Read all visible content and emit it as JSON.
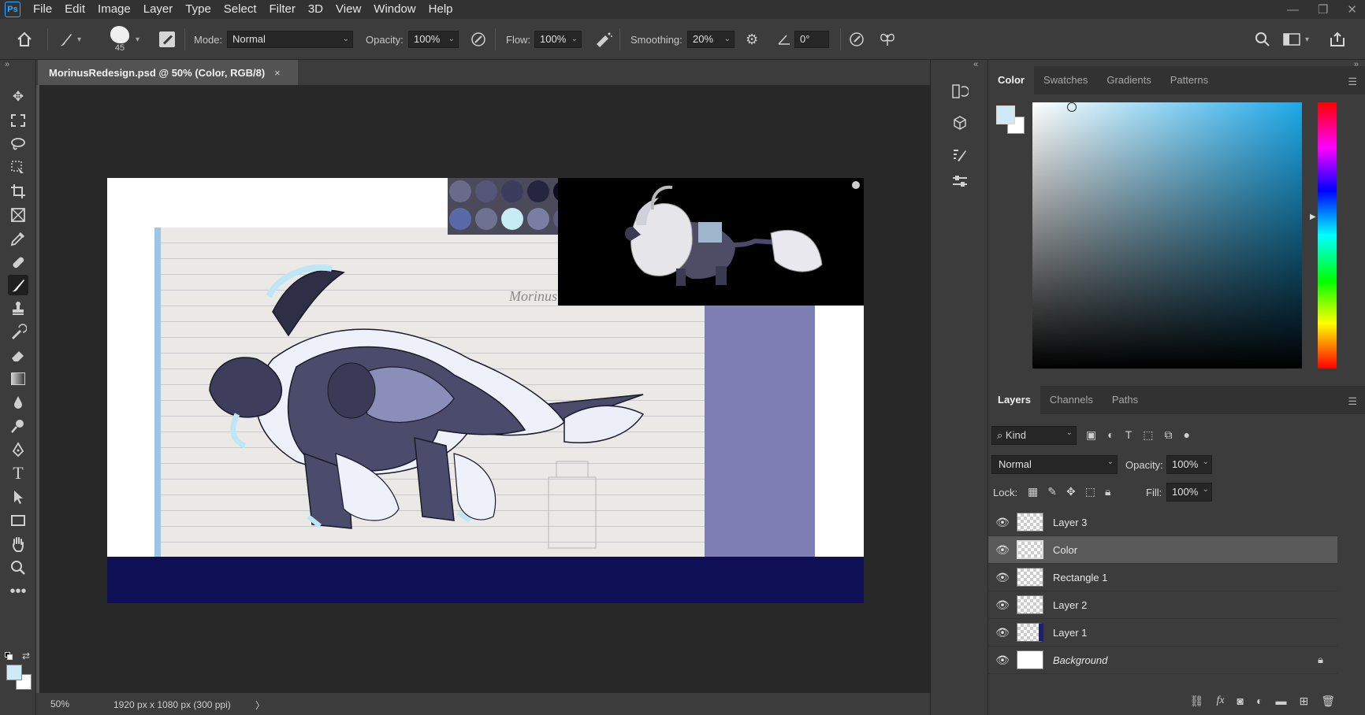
{
  "app": {
    "logo": "Ps"
  },
  "menu": [
    "File",
    "Edit",
    "Image",
    "Layer",
    "Type",
    "Select",
    "Filter",
    "3D",
    "View",
    "Window",
    "Help"
  ],
  "window_controls": {
    "minimize": "—",
    "restore": "❐",
    "close": "✕"
  },
  "options": {
    "brush_size": "45",
    "mode_label": "Mode:",
    "mode_value": "Normal",
    "opacity_label": "Opacity:",
    "opacity_value": "100%",
    "flow_label": "Flow:",
    "flow_value": "100%",
    "smoothing_label": "Smoothing:",
    "smoothing_value": "20%",
    "angle_value": "0°"
  },
  "document": {
    "tab_title": "MorinusRedesign.psd @ 50% (Color, RGB/8)",
    "close_glyph": "×",
    "sketch_label": "Morinus"
  },
  "status": {
    "zoom": "50%",
    "doc_info": "1920 px x 1080 px (300 ppi)",
    "arrow": "〉"
  },
  "color_panel": {
    "tabs": [
      "Color",
      "Swatches",
      "Gradients",
      "Patterns"
    ],
    "active_tab": "Color",
    "foreground": "#cfeaf7",
    "background": "#ffffff",
    "hue_color": "#1ea8e8"
  },
  "palette_swatches": [
    "#6a6a8a",
    "#55557a",
    "#3c3c5c",
    "#25253f",
    "#0c0c22",
    "#e6eaf8",
    "#5a6aa8",
    "#6e7290",
    "#c8ecf6",
    "#7a7ea2",
    "#5a5c80",
    "#4a4e7a"
  ],
  "layers_panel": {
    "tabs": [
      "Layers",
      "Channels",
      "Paths"
    ],
    "active_tab": "Layers",
    "kind_label": "Kind",
    "blend_mode": "Normal",
    "opacity_label": "Opacity:",
    "opacity_value": "100%",
    "lock_label": "Lock:",
    "fill_label": "Fill:",
    "fill_value": "100%",
    "layers": [
      {
        "name": "Layer 3",
        "selected": false,
        "locked": false
      },
      {
        "name": "Color",
        "selected": true,
        "locked": false
      },
      {
        "name": "Rectangle 1",
        "selected": false,
        "locked": false
      },
      {
        "name": "Layer 2",
        "selected": false,
        "locked": false
      },
      {
        "name": "Layer 1",
        "selected": false,
        "locked": false
      },
      {
        "name": "Background",
        "selected": false,
        "locked": true
      }
    ]
  }
}
